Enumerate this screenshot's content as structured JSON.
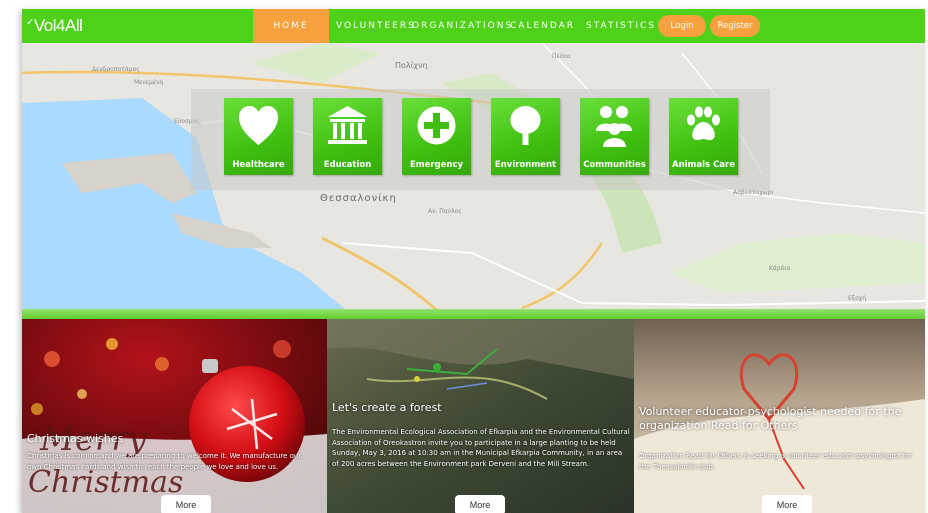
{
  "header": {
    "logo": "Vol4All",
    "nav": [
      "HOME",
      "VOLUNTEERS",
      "ORGANIZATIONS",
      "CALENDAR",
      "STATISTICS"
    ],
    "login": "Login",
    "register": "Register"
  },
  "map": {
    "labels": [
      "Πολίχνη",
      "Πεύκα",
      "Δενδροποτάμος",
      "Μενεμένη",
      "Θεσσαλονίκη",
      "Αν. Παύλος",
      "Ασβεστοχώρι",
      "Κάρδια",
      "Εξοχή",
      "Εύοσμος"
    ]
  },
  "categories": [
    {
      "label": "Healthcare",
      "icon": "heart-icon"
    },
    {
      "label": "Education",
      "icon": "building-columns-icon"
    },
    {
      "label": "Emergency",
      "icon": "plus-circle-icon"
    },
    {
      "label": "Environment",
      "icon": "tree-icon"
    },
    {
      "label": "Communities",
      "icon": "people-group-icon"
    },
    {
      "label": "Animals Care",
      "icon": "paw-icon"
    }
  ],
  "cards": [
    {
      "title": "Christmas wishes",
      "body": "Christmas is coming and we are preparing to welcome it. We manufacture our own Christmas cards and wish to reach the people we love and love us.",
      "overlay_1": "Merry",
      "overlay_2": "Christmas",
      "button": "More"
    },
    {
      "title": "Let's create a forest",
      "body": "The Environmental Ecological Association of Efkarpia and the Environmental Cultural Association of Oreokastron invite you to participate in a large planting to be held Sunday, May 3, 2016 at 10:30 am in the Municipal Efkarpia Community, in an area of 200 acres between the Environment park Derveni and the Mill Stream.",
      "button": "More"
    },
    {
      "title": "Volunteer educator-psychologist needed for the organization Read for Others",
      "body": "Organization Read for Others is seeking a volunteer educator-psychologist for the Thessaloniki club.",
      "button": "More"
    }
  ],
  "colors": {
    "brand_green": "#4fd11a",
    "accent_orange": "#f6a13d"
  }
}
